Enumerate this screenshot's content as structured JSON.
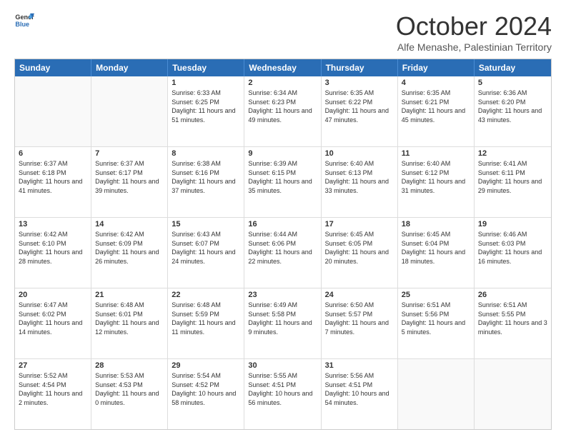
{
  "logo": {
    "general": "General",
    "blue": "Blue"
  },
  "title": "October 2024",
  "subtitle": "Alfe Menashe, Palestinian Territory",
  "days": [
    "Sunday",
    "Monday",
    "Tuesday",
    "Wednesday",
    "Thursday",
    "Friday",
    "Saturday"
  ],
  "weeks": [
    [
      {
        "day": "",
        "content": ""
      },
      {
        "day": "",
        "content": ""
      },
      {
        "day": "1",
        "content": "Sunrise: 6:33 AM\nSunset: 6:25 PM\nDaylight: 11 hours and 51 minutes."
      },
      {
        "day": "2",
        "content": "Sunrise: 6:34 AM\nSunset: 6:23 PM\nDaylight: 11 hours and 49 minutes."
      },
      {
        "day": "3",
        "content": "Sunrise: 6:35 AM\nSunset: 6:22 PM\nDaylight: 11 hours and 47 minutes."
      },
      {
        "day": "4",
        "content": "Sunrise: 6:35 AM\nSunset: 6:21 PM\nDaylight: 11 hours and 45 minutes."
      },
      {
        "day": "5",
        "content": "Sunrise: 6:36 AM\nSunset: 6:20 PM\nDaylight: 11 hours and 43 minutes."
      }
    ],
    [
      {
        "day": "6",
        "content": "Sunrise: 6:37 AM\nSunset: 6:18 PM\nDaylight: 11 hours and 41 minutes."
      },
      {
        "day": "7",
        "content": "Sunrise: 6:37 AM\nSunset: 6:17 PM\nDaylight: 11 hours and 39 minutes."
      },
      {
        "day": "8",
        "content": "Sunrise: 6:38 AM\nSunset: 6:16 PM\nDaylight: 11 hours and 37 minutes."
      },
      {
        "day": "9",
        "content": "Sunrise: 6:39 AM\nSunset: 6:15 PM\nDaylight: 11 hours and 35 minutes."
      },
      {
        "day": "10",
        "content": "Sunrise: 6:40 AM\nSunset: 6:13 PM\nDaylight: 11 hours and 33 minutes."
      },
      {
        "day": "11",
        "content": "Sunrise: 6:40 AM\nSunset: 6:12 PM\nDaylight: 11 hours and 31 minutes."
      },
      {
        "day": "12",
        "content": "Sunrise: 6:41 AM\nSunset: 6:11 PM\nDaylight: 11 hours and 29 minutes."
      }
    ],
    [
      {
        "day": "13",
        "content": "Sunrise: 6:42 AM\nSunset: 6:10 PM\nDaylight: 11 hours and 28 minutes."
      },
      {
        "day": "14",
        "content": "Sunrise: 6:42 AM\nSunset: 6:09 PM\nDaylight: 11 hours and 26 minutes."
      },
      {
        "day": "15",
        "content": "Sunrise: 6:43 AM\nSunset: 6:07 PM\nDaylight: 11 hours and 24 minutes."
      },
      {
        "day": "16",
        "content": "Sunrise: 6:44 AM\nSunset: 6:06 PM\nDaylight: 11 hours and 22 minutes."
      },
      {
        "day": "17",
        "content": "Sunrise: 6:45 AM\nSunset: 6:05 PM\nDaylight: 11 hours and 20 minutes."
      },
      {
        "day": "18",
        "content": "Sunrise: 6:45 AM\nSunset: 6:04 PM\nDaylight: 11 hours and 18 minutes."
      },
      {
        "day": "19",
        "content": "Sunrise: 6:46 AM\nSunset: 6:03 PM\nDaylight: 11 hours and 16 minutes."
      }
    ],
    [
      {
        "day": "20",
        "content": "Sunrise: 6:47 AM\nSunset: 6:02 PM\nDaylight: 11 hours and 14 minutes."
      },
      {
        "day": "21",
        "content": "Sunrise: 6:48 AM\nSunset: 6:01 PM\nDaylight: 11 hours and 12 minutes."
      },
      {
        "day": "22",
        "content": "Sunrise: 6:48 AM\nSunset: 5:59 PM\nDaylight: 11 hours and 11 minutes."
      },
      {
        "day": "23",
        "content": "Sunrise: 6:49 AM\nSunset: 5:58 PM\nDaylight: 11 hours and 9 minutes."
      },
      {
        "day": "24",
        "content": "Sunrise: 6:50 AM\nSunset: 5:57 PM\nDaylight: 11 hours and 7 minutes."
      },
      {
        "day": "25",
        "content": "Sunrise: 6:51 AM\nSunset: 5:56 PM\nDaylight: 11 hours and 5 minutes."
      },
      {
        "day": "26",
        "content": "Sunrise: 6:51 AM\nSunset: 5:55 PM\nDaylight: 11 hours and 3 minutes."
      }
    ],
    [
      {
        "day": "27",
        "content": "Sunrise: 5:52 AM\nSunset: 4:54 PM\nDaylight: 11 hours and 2 minutes."
      },
      {
        "day": "28",
        "content": "Sunrise: 5:53 AM\nSunset: 4:53 PM\nDaylight: 11 hours and 0 minutes."
      },
      {
        "day": "29",
        "content": "Sunrise: 5:54 AM\nSunset: 4:52 PM\nDaylight: 10 hours and 58 minutes."
      },
      {
        "day": "30",
        "content": "Sunrise: 5:55 AM\nSunset: 4:51 PM\nDaylight: 10 hours and 56 minutes."
      },
      {
        "day": "31",
        "content": "Sunrise: 5:56 AM\nSunset: 4:51 PM\nDaylight: 10 hours and 54 minutes."
      },
      {
        "day": "",
        "content": ""
      },
      {
        "day": "",
        "content": ""
      }
    ]
  ]
}
